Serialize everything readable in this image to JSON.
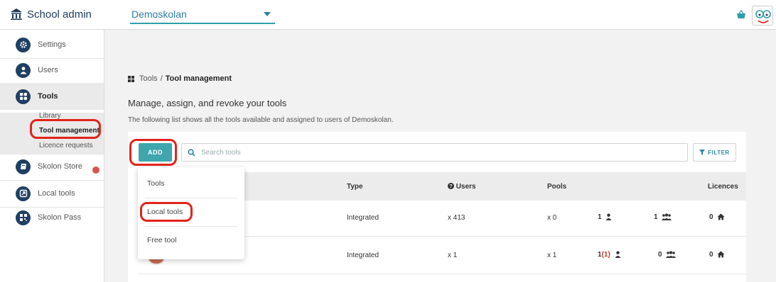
{
  "topbar": {
    "brand": "School admin",
    "school_selected": "Demoskolan"
  },
  "sidebar": {
    "items": [
      {
        "label": "Settings",
        "icon": "gear-icon"
      },
      {
        "label": "Users",
        "icon": "user-icon"
      },
      {
        "label": "Tools",
        "icon": "grid-icon"
      },
      {
        "label": "Skolon Store",
        "icon": "book-icon"
      },
      {
        "label": "Local tools",
        "icon": "external-link-icon"
      },
      {
        "label": "Skolon Pass",
        "icon": "qr-icon"
      }
    ],
    "tools_sub": [
      "Library",
      "Tool management",
      "Licence requests"
    ]
  },
  "breadcrumb": {
    "root": "Tools",
    "separator": "/",
    "current": "Tool management"
  },
  "main": {
    "title": "Manage, assign, and revoke your tools",
    "description": "The following list shows all the tools available and assigned to users of Demoskolan.",
    "add_label": "ADD",
    "search_placeholder": "Search tools",
    "filter_label": "FILTER"
  },
  "table": {
    "headers": {
      "type": "Type",
      "users": "Users",
      "pools": "Pools",
      "licences": "Licences"
    },
    "rows": [
      {
        "type": "Integrated",
        "users": "x 413",
        "pools": "x 0",
        "user_lic": "1",
        "user_lic_extra": "",
        "group_lic": "1",
        "school_lic": "0"
      },
      {
        "type": "Integrated",
        "users": "x 1",
        "pools": "x 1",
        "user_lic": "1",
        "user_lic_extra": "(1)",
        "group_lic": "0",
        "school_lic": "0"
      }
    ]
  },
  "dropdown": {
    "items": [
      "Tools",
      "Local tools",
      "Free tool"
    ]
  },
  "colors": {
    "navy": "#1f3f63",
    "teal": "#3fa6ad",
    "highlight": "#e2231a"
  }
}
